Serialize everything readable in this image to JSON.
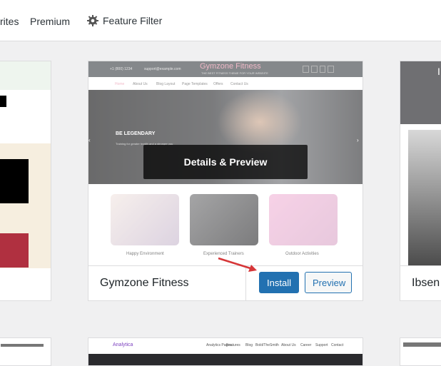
{
  "nav": {
    "favorites_partial": "rites",
    "premium": "Premium",
    "feature_filter": "Feature Filter"
  },
  "icons": {
    "gear": "gear-icon",
    "arrow": "red-arrow-icon",
    "prev": "chevron-left-icon",
    "next": "chevron-right-icon"
  },
  "main_card": {
    "theme_name": "Gymzone Fitness",
    "install_label": "Install",
    "preview_label": "Preview",
    "details_preview_label": "Details & Preview",
    "screenshot": {
      "site_title": "Gymzone Fitness",
      "tagline": "THE BEST FITNESS THEME FOR YOUR WEBSITE",
      "phone": "+1 (800) 1234",
      "email": "support@example.com",
      "menu": [
        "Home",
        "About Us",
        "Blog Layout",
        "Page Templates",
        "Offers",
        "Contact Us"
      ],
      "hero_heading": "BE LEGENDARY",
      "hero_text": "Training for greater health and a stronger you",
      "features": [
        "Happy Environment",
        "Experienced Trainers",
        "Outdoor Activities"
      ]
    }
  },
  "right_card": {
    "theme_name_partial": "Ibsen",
    "header_partial": "I"
  },
  "bottom_row": {
    "center_logo": "Analytica",
    "center_menu": [
      "Analytics Pages",
      "Features",
      "Blog",
      "Bold/TheSmith",
      "About Us",
      "Career",
      "Support",
      "Contact"
    ]
  },
  "colors": {
    "accent": "#2271b1",
    "pink": "#e88fa7",
    "arrow": "#d63638"
  }
}
